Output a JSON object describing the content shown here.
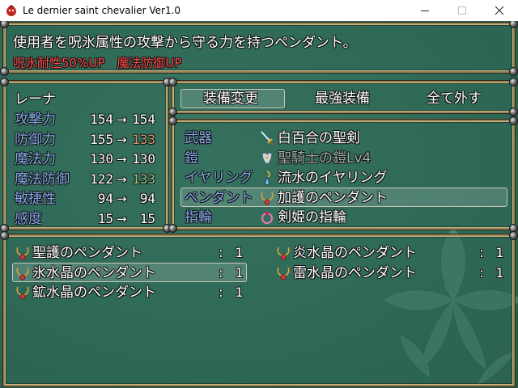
{
  "window": {
    "title": "Le dernier saint chevalier Ver1.0",
    "controls": {
      "minimize": "—",
      "maximize": "☐",
      "close": "✕"
    }
  },
  "help": {
    "line1": "使用者を呪氷属性の攻撃から守る力を持つペンダント。",
    "line2": "呪氷耐性50%UP　魔法防御UP"
  },
  "status": {
    "actor": "レーナ",
    "arrow": "→",
    "params": [
      {
        "label": "攻撃力",
        "current": "154",
        "new": "154",
        "change": "same"
      },
      {
        "label": "防御力",
        "current": "155",
        "new": "133",
        "change": "down"
      },
      {
        "label": "魔法力",
        "current": "130",
        "new": "130",
        "change": "same"
      },
      {
        "label": "魔法防御",
        "current": "122",
        "new": "133",
        "change": "up"
      },
      {
        "label": "敏捷性",
        "current": "94",
        "new": "94",
        "change": "same"
      },
      {
        "label": "感度",
        "current": "15",
        "new": "15",
        "change": "same"
      }
    ]
  },
  "commands": {
    "items": [
      "装備変更",
      "最強装備",
      "全て外す"
    ],
    "selected": 0
  },
  "slots": [
    {
      "slot": "武器",
      "item": "白百合の聖剣",
      "icon": "sword-icon",
      "enabled": true
    },
    {
      "slot": "鎧",
      "item": "聖騎士の鎧Lv4",
      "icon": "armor-icon",
      "enabled": false
    },
    {
      "slot": "イヤリング",
      "item": "流水のイヤリング",
      "icon": "earring-icon",
      "enabled": true
    },
    {
      "slot": "ペンダント",
      "item": "加護のペンダント",
      "icon": "pendant-icon",
      "enabled": true
    },
    {
      "slot": "指輪",
      "item": "剣姫の指輪",
      "icon": "ring-icon",
      "enabled": true
    }
  ],
  "selected_slot": 3,
  "inventory": {
    "separator": ":",
    "items": [
      {
        "name": "聖護のペンダント",
        "count": "1"
      },
      {
        "name": "炎水晶のペンダント",
        "count": "1"
      },
      {
        "name": "氷水晶のペンダント",
        "count": "1"
      },
      {
        "name": "雷水晶のペンダント",
        "count": "1"
      },
      {
        "name": "鉱水晶のペンダント",
        "count": "1"
      }
    ],
    "selected": 2
  },
  "colors": {
    "system": "#84a7e8",
    "warning": "#ff4b4b",
    "increase": "#9ad18a",
    "decrease": "#d49a6e",
    "frame": "#9a8559"
  }
}
